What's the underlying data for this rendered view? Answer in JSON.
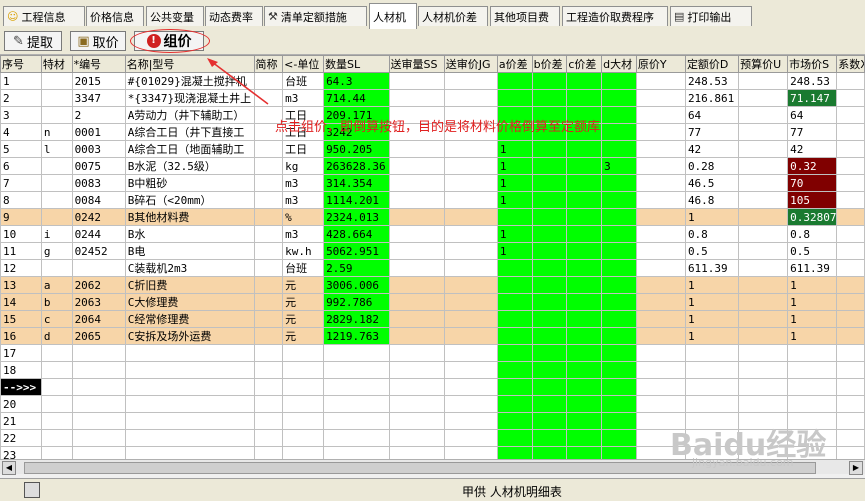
{
  "tabs": [
    {
      "label": "工程信息",
      "icon": "smiley-icon"
    },
    {
      "label": "价格信息"
    },
    {
      "label": "公共变量"
    },
    {
      "label": "动态费率"
    },
    {
      "label": "清单定额措施",
      "icon": "tools-icon"
    },
    {
      "label": "人材机",
      "active": true
    },
    {
      "label": "人材机价差"
    },
    {
      "label": "其他项目费"
    },
    {
      "label": "工程造价取费程序"
    },
    {
      "label": "打印输出",
      "icon": "printer-icon"
    }
  ],
  "toolbar": {
    "extract": "提取",
    "pick_price": "取价",
    "group_price": "组价"
  },
  "annotation": "点击组价，即倒算按钮，目的是将材料价格倒算至定额库",
  "columns": [
    "序号",
    "特材",
    "*编号",
    "名称|型号",
    "简称",
    "<-单位",
    "数量SL",
    "送审量SS",
    "送审价JG",
    "a价差",
    "b价差",
    "c价差",
    "d大材",
    "原价Y",
    "定额价D",
    "预算价U",
    "市场价S",
    "系数XS"
  ],
  "rows": [
    {
      "seq": "1",
      "tc": "",
      "code": "2015",
      "name": "#{01029}混凝土搅拌机",
      "unit": "台班",
      "qty": "64.3",
      "a": "",
      "b": "",
      "c": "",
      "d": "",
      "ding": "248.53",
      "shi": "248.53"
    },
    {
      "seq": "2",
      "tc": "",
      "code": "3347",
      "name": "*{3347}现浇混凝土井上",
      "unit": "m3",
      "qty": "714.44",
      "a": "",
      "b": "",
      "c": "",
      "d": "",
      "ding": "216.861",
      "shi": "71.147",
      "shi_style": "dg"
    },
    {
      "seq": "3",
      "tc": "",
      "code": "2",
      "name": "A劳动力（井下辅助工）",
      "unit": "工日",
      "qty": "209.171",
      "a": "",
      "b": "",
      "c": "",
      "d": "",
      "ding": "64",
      "shi": "64"
    },
    {
      "seq": "4",
      "tc": "n",
      "code": "0001",
      "name": "A综合工日（井下直接工",
      "unit": "工日",
      "qty": "3242",
      "a": "",
      "b": "",
      "c": "",
      "d": "",
      "ding": "77",
      "shi": "77"
    },
    {
      "seq": "5",
      "tc": "l",
      "code": "0003",
      "name": "A综合工日（地面辅助工",
      "unit": "工日",
      "qty": "950.205",
      "a": "1",
      "b": "",
      "c": "",
      "d": "",
      "ding": "42",
      "shi": "42"
    },
    {
      "seq": "6",
      "tc": "",
      "code": "0075",
      "name": "B水泥（32.5级）",
      "unit": "kg",
      "qty": "263628.36",
      "a": "1",
      "b": "",
      "c": "",
      "d": "3",
      "ding": "0.28",
      "shi": "0.32",
      "shi_style": "dr"
    },
    {
      "seq": "7",
      "tc": "",
      "code": "0083",
      "name": "B中粗砂",
      "unit": "m3",
      "qty": "314.354",
      "a": "1",
      "b": "",
      "c": "",
      "d": "",
      "ding": "46.5",
      "shi": "70",
      "shi_style": "dr"
    },
    {
      "seq": "8",
      "tc": "",
      "code": "0084",
      "name": "B碎石（<20mm）",
      "unit": "m3",
      "qty": "1114.201",
      "a": "1",
      "b": "",
      "c": "",
      "d": "",
      "ding": "46.8",
      "shi": "105",
      "shi_style": "dr"
    },
    {
      "seq": "9",
      "tc": "",
      "code": "0242",
      "name": "B其他材料费",
      "unit": "%",
      "qty": "2324.013",
      "a": "",
      "b": "",
      "c": "",
      "d": "",
      "ding": "1",
      "shi": "0.328077",
      "shi_style": "dg",
      "alt": true
    },
    {
      "seq": "10",
      "tc": "i",
      "code": "0244",
      "name": "B水",
      "unit": "m3",
      "qty": "428.664",
      "a": "1",
      "b": "",
      "c": "",
      "d": "",
      "ding": "0.8",
      "shi": "0.8"
    },
    {
      "seq": "11",
      "tc": "g",
      "code": "02452",
      "name": "B电",
      "unit": "kw.h",
      "qty": "5062.951",
      "a": "1",
      "b": "",
      "c": "",
      "d": "",
      "ding": "0.5",
      "shi": "0.5"
    },
    {
      "seq": "12",
      "tc": "",
      "code": "",
      "name": "C装载机2m3",
      "unit": "台班",
      "qty": "2.59",
      "a": "",
      "b": "",
      "c": "",
      "d": "",
      "ding": "611.39",
      "shi": "611.39"
    },
    {
      "seq": "13",
      "tc": "a",
      "code": "2062",
      "name": "C折旧费",
      "unit": "元",
      "qty": "3006.006",
      "a": "",
      "b": "",
      "c": "",
      "d": "",
      "ding": "1",
      "shi": "1",
      "alt": true
    },
    {
      "seq": "14",
      "tc": "b",
      "code": "2063",
      "name": "C大修理费",
      "unit": "元",
      "qty": "992.786",
      "a": "",
      "b": "",
      "c": "",
      "d": "",
      "ding": "1",
      "shi": "1",
      "alt": true
    },
    {
      "seq": "15",
      "tc": "c",
      "code": "2064",
      "name": "C经常修理费",
      "unit": "元",
      "qty": "2829.182",
      "a": "",
      "b": "",
      "c": "",
      "d": "",
      "ding": "1",
      "shi": "1",
      "alt": true
    },
    {
      "seq": "16",
      "tc": "d",
      "code": "2065",
      "name": "C安拆及场外运费",
      "unit": "元",
      "qty": "1219.763",
      "a": "",
      "b": "",
      "c": "",
      "d": "",
      "ding": "1",
      "shi": "1",
      "alt": true
    }
  ],
  "empty_rows": [
    "17",
    "18",
    "-->>>",
    "20",
    "21",
    "22",
    "23"
  ],
  "status_text": "甲供 人材机明细表",
  "watermark": "Baidu经验",
  "watermark_url": "jingyan.baidu.com",
  "colors": {
    "green": "#00ff00",
    "dark_red": "#800000",
    "dark_green": "#1a7a30",
    "peach": "#f7d5a8",
    "annotation": "#e02020"
  }
}
